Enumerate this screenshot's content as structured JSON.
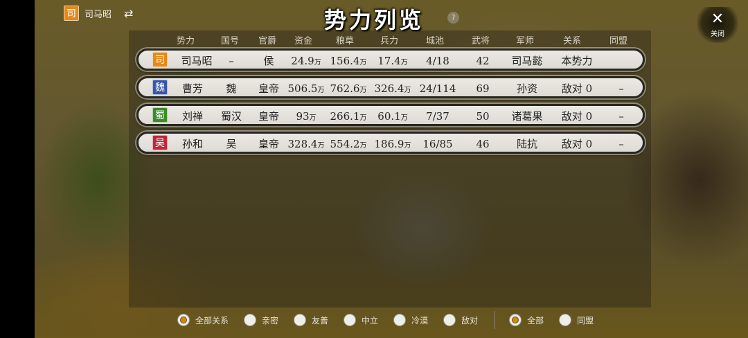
{
  "top": {
    "faction_seal": "司",
    "faction_name": "司马昭",
    "swap_icon": "⇄"
  },
  "title": "势力列览",
  "help_icon": "?",
  "close": {
    "label": "关闭",
    "icon": "✕"
  },
  "table": {
    "headers": [
      "势力",
      "国号",
      "官爵",
      "资金",
      "粮草",
      "兵力",
      "城池",
      "武将",
      "军师",
      "关系",
      "同盟"
    ],
    "unit": "万",
    "rows": [
      {
        "seal": "司",
        "seal_color": "#e38a1e",
        "name": "司马昭",
        "country": "–",
        "rank": "侯",
        "funds": "24.9",
        "food": "156.4",
        "troops": "17.4",
        "cities": "4/18",
        "generals": "42",
        "strategist": "司马懿",
        "relation": "本势力",
        "alliance": ""
      },
      {
        "seal": "魏",
        "seal_color": "#3a55a8",
        "name": "曹芳",
        "country": "魏",
        "rank": "皇帝",
        "funds": "506.5",
        "food": "762.6",
        "troops": "326.4",
        "cities": "24/114",
        "generals": "69",
        "strategist": "孙资",
        "relation": "敌对 0",
        "alliance": "–"
      },
      {
        "seal": "蜀",
        "seal_color": "#3d8a2a",
        "name": "刘禅",
        "country": "蜀汉",
        "rank": "皇帝",
        "funds": "93",
        "food": "266.1",
        "troops": "60.1",
        "cities": "7/37",
        "generals": "50",
        "strategist": "诸葛果",
        "relation": "敌对 0",
        "alliance": "–"
      },
      {
        "seal": "吴",
        "seal_color": "#c0283a",
        "name": "孙和",
        "country": "吴",
        "rank": "皇帝",
        "funds": "328.4",
        "food": "554.2",
        "troops": "186.9",
        "cities": "16/85",
        "generals": "46",
        "strategist": "陆抗",
        "relation": "敌对 0",
        "alliance": "–"
      }
    ]
  },
  "filters": {
    "relations": [
      {
        "label": "全部关系",
        "selected": true
      },
      {
        "label": "亲密",
        "selected": false
      },
      {
        "label": "友善",
        "selected": false
      },
      {
        "label": "中立",
        "selected": false
      },
      {
        "label": "冷漠",
        "selected": false
      },
      {
        "label": "敌对",
        "selected": false
      }
    ],
    "alliance": [
      {
        "label": "全部",
        "selected": true
      },
      {
        "label": "同盟",
        "selected": false
      }
    ]
  }
}
